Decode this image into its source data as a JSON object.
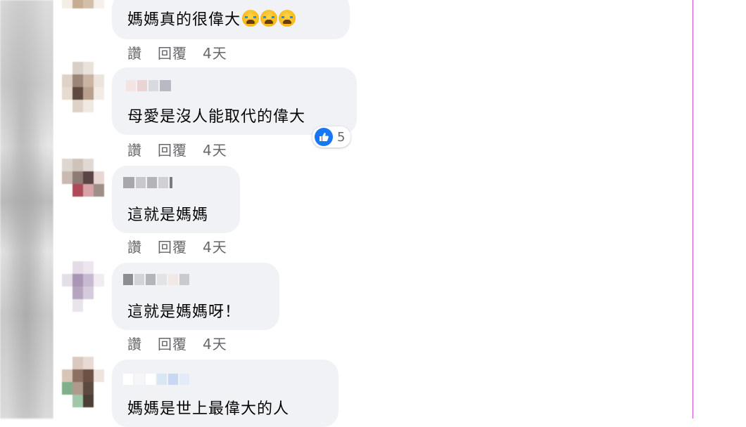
{
  "actions": {
    "like_label": "讚",
    "reply_label": "回覆"
  },
  "comments": [
    {
      "text": "媽媽真的很偉大",
      "emojis": [
        "crying-face",
        "crying-face",
        "crying-face"
      ],
      "time": "4天"
    },
    {
      "text": "母愛是沒人能取代的偉大",
      "reaction_count": "5",
      "time": "4天"
    },
    {
      "text": "這就是媽媽",
      "time": "4天"
    },
    {
      "text": "這就是媽媽呀！",
      "time": "4天"
    },
    {
      "text": "媽媽是世上最偉大的人"
    }
  ],
  "colors": {
    "bubble": "#f0f2f5",
    "secondary_text": "#65676b",
    "like_blue": "#1877f2",
    "frame_line": "#d44cd8"
  }
}
